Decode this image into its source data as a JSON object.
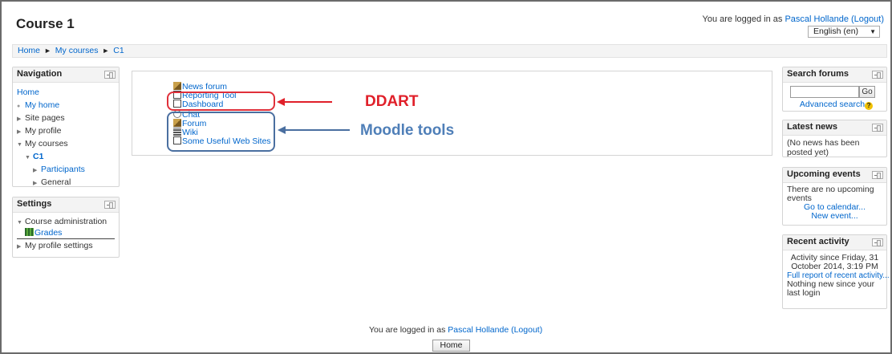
{
  "page": {
    "title": "Course 1"
  },
  "header": {
    "login_prefix": "You are logged in as ",
    "user_name": "Pascal Hollande",
    "logout": "(Logout)",
    "language": "English (en)"
  },
  "breadcrumb": {
    "items": [
      "Home",
      "My courses",
      "C1"
    ],
    "separator": "►"
  },
  "navigation": {
    "title": "Navigation",
    "home": "Home",
    "my_home": "My home",
    "site_pages": "Site pages",
    "my_profile": "My profile",
    "my_courses": "My courses",
    "c1": "C1",
    "participants": "Participants",
    "general": "General"
  },
  "settings": {
    "title": "Settings",
    "course_admin": "Course administration",
    "grades": "Grades",
    "profile_settings": "My profile settings"
  },
  "activities": [
    {
      "label": "News forum",
      "icon": "forum-icon"
    },
    {
      "label": "Reporting Tool",
      "icon": "document-icon"
    },
    {
      "label": "Dashboard",
      "icon": "document-icon"
    },
    {
      "label": "Chat",
      "icon": "chat-icon"
    },
    {
      "label": "Forum",
      "icon": "forum-icon"
    },
    {
      "label": "Wiki",
      "icon": "wiki-icon"
    },
    {
      "label": "Some Useful Web Sites",
      "icon": "document-icon"
    }
  ],
  "annotations": {
    "ddart": "DDART",
    "moodle_tools": "Moodle tools",
    "red": "#e0202a",
    "blue": "#4f7fb8"
  },
  "search_forums": {
    "title": "Search forums",
    "go": "Go",
    "advanced": "Advanced search"
  },
  "latest_news": {
    "title": "Latest news",
    "text": "(No news has been posted yet)"
  },
  "upcoming_events": {
    "title": "Upcoming events",
    "text": "There are no upcoming events",
    "calendar": "Go to calendar...",
    "new_event": "New event..."
  },
  "recent_activity": {
    "title": "Recent activity",
    "since": "Activity since Friday, 31 October 2014, 3:19 PM",
    "full_report": "Full report of recent activity...",
    "nothing": "Nothing new since your last login"
  },
  "footer": {
    "login_prefix": "You are logged in as ",
    "user_name": "Pascal Hollande",
    "logout": "(Logout)",
    "home_button": "Home"
  }
}
